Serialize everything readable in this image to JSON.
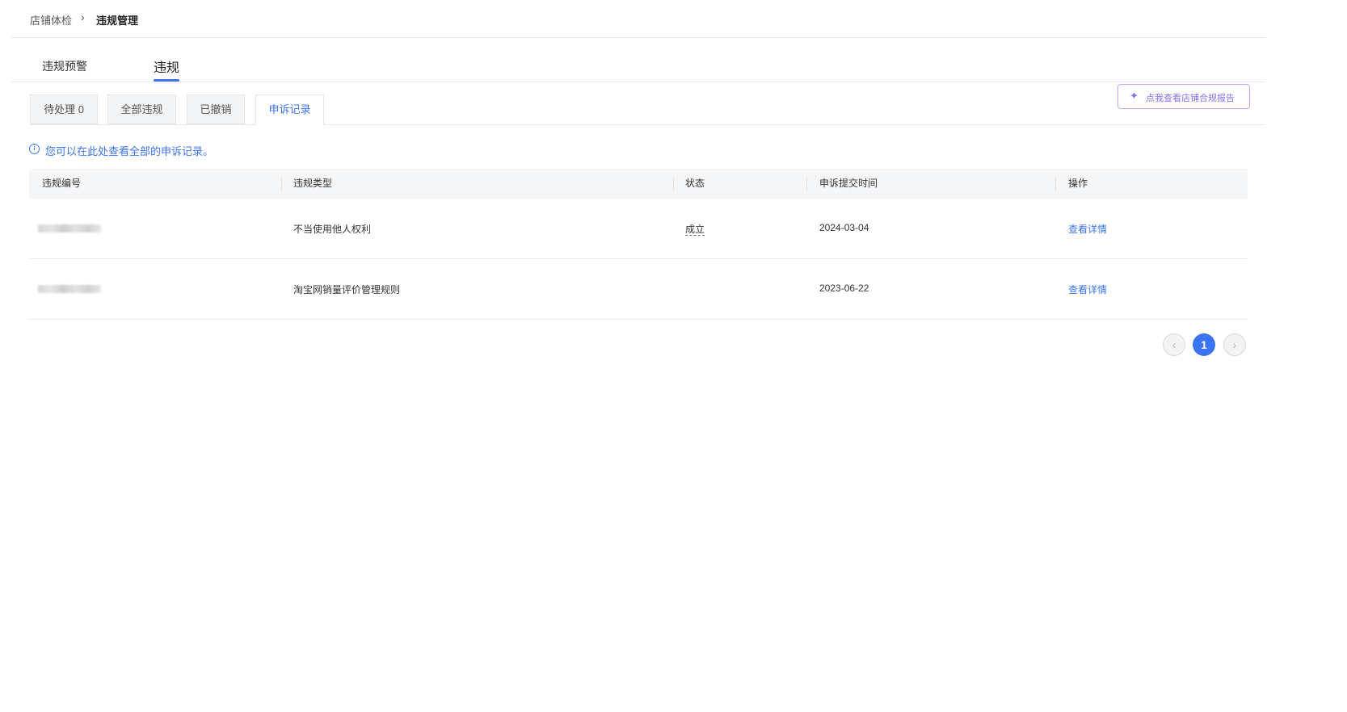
{
  "breadcrumb": {
    "root": "店铺体检",
    "separator": "›",
    "current": "违规管理"
  },
  "main_tabs": [
    {
      "label": "违规预警",
      "active": false
    },
    {
      "label": "违规",
      "active": true
    }
  ],
  "sub_tabs": [
    {
      "label": "待处理 0",
      "active": false
    },
    {
      "label": "全部违规",
      "active": false
    },
    {
      "label": "已撤销",
      "active": false
    },
    {
      "label": "申诉记录",
      "active": true
    }
  ],
  "report_button": {
    "icon": "sparkle-wand-icon",
    "label": "点我查看店铺合规报告"
  },
  "notice": {
    "icon": "info-icon",
    "text": "您可以在此处查看全部的申诉记录。"
  },
  "table": {
    "columns": [
      "违规编号",
      "违规类型",
      "状态",
      "申诉提交时间",
      "操作"
    ],
    "rows": [
      {
        "id_blurred": true,
        "type": "不当使用他人权利",
        "status": "成立",
        "submit_time": "2024-03-04",
        "action": "查看详情"
      },
      {
        "id_blurred": true,
        "type": "淘宝网销量评价管理规则",
        "status": "",
        "submit_time": "2023-06-22",
        "action": "查看详情"
      }
    ]
  },
  "pagination": {
    "prev": "‹",
    "current_page": "1",
    "next": "›"
  },
  "colors": {
    "accent": "#3a74f0",
    "report_border": "#c9a4f5",
    "report_text": "#8a6df2"
  }
}
